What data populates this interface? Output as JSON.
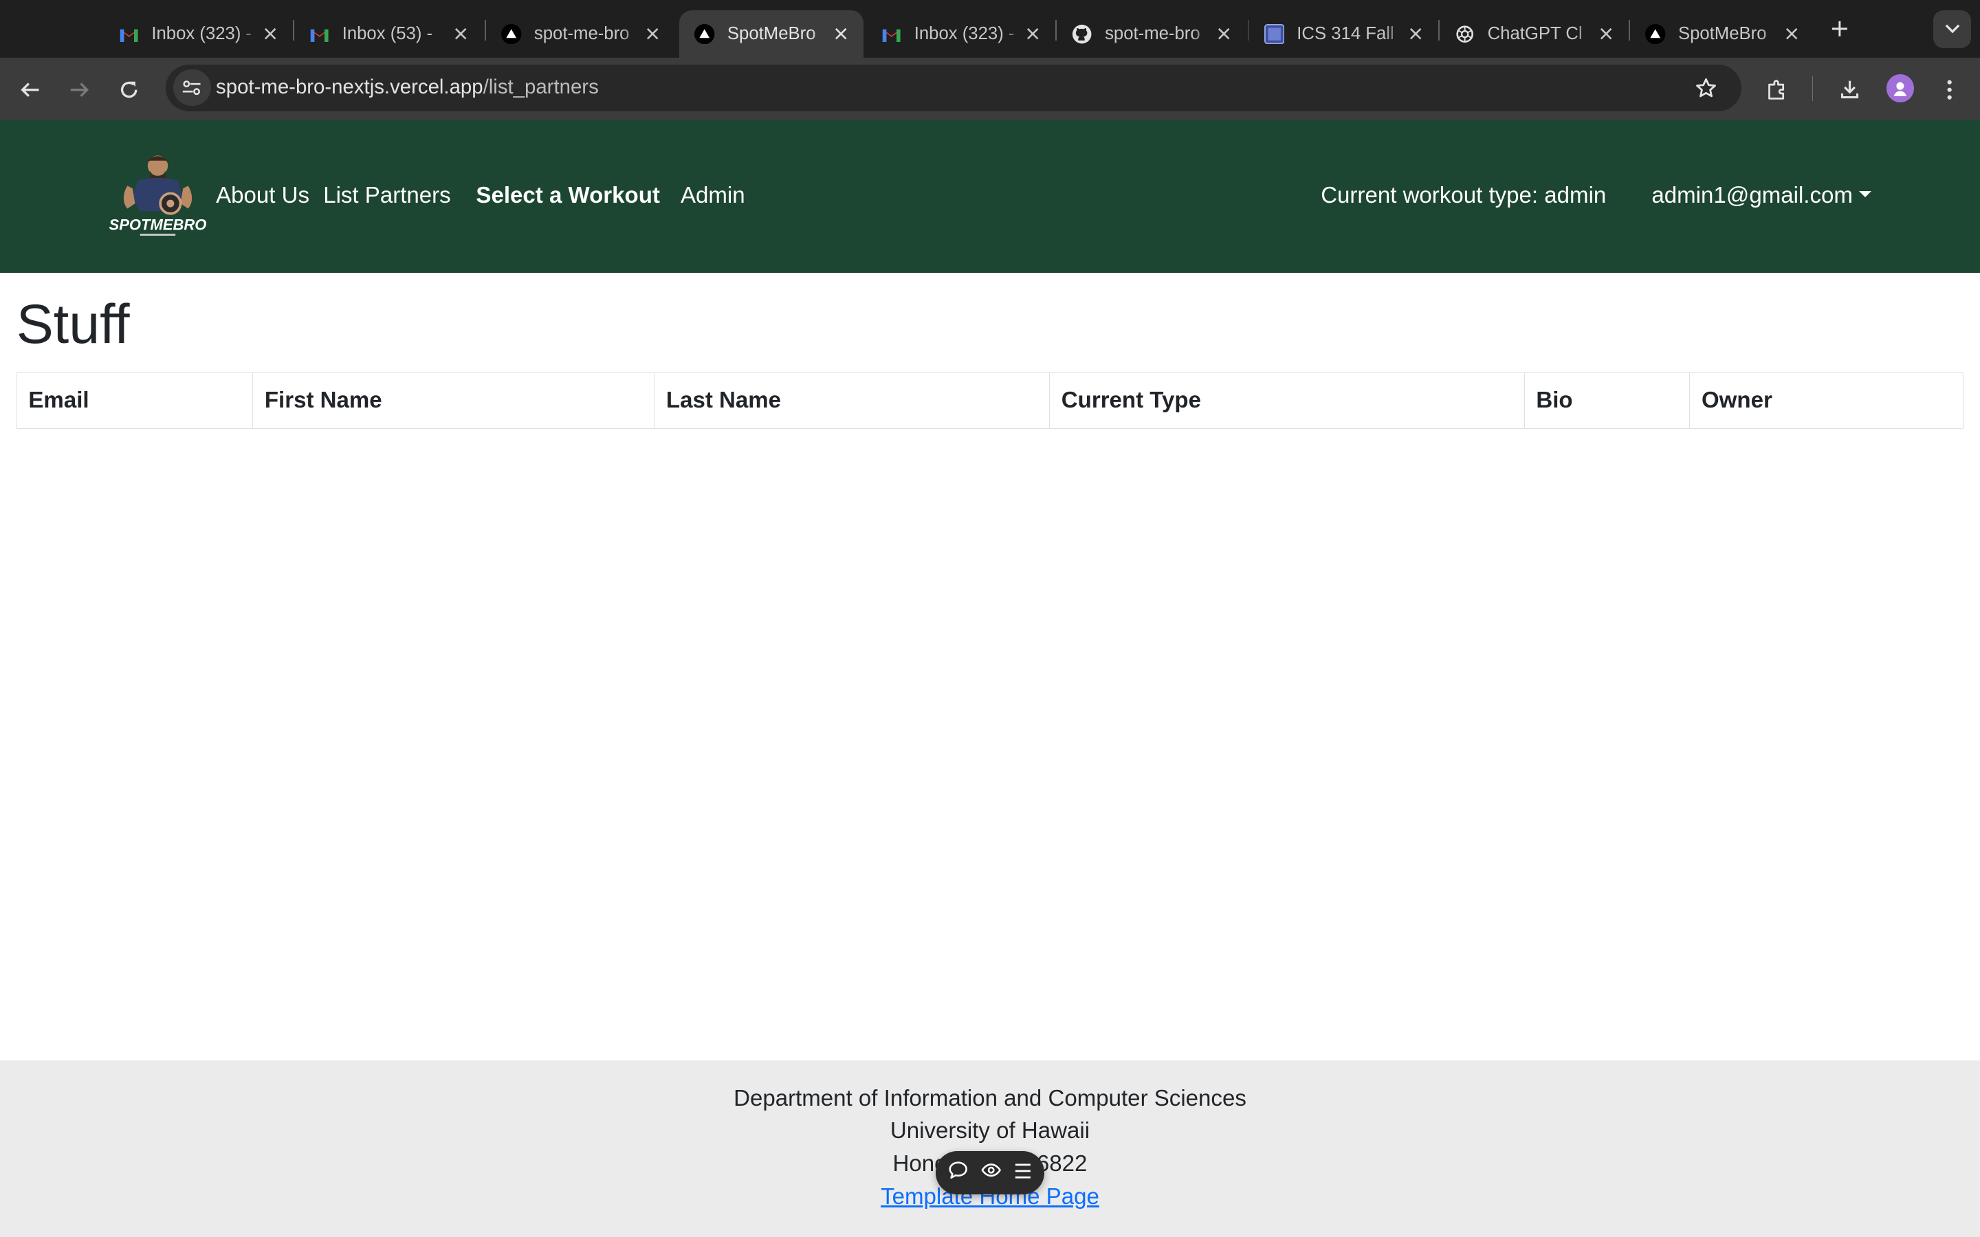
{
  "browser": {
    "tabs": [
      {
        "title": "Inbox (323) - ",
        "icon": "gmail-icon",
        "active": false
      },
      {
        "title": "Inbox (53) - ",
        "icon": "gmail-icon",
        "active": false
      },
      {
        "title": "spot-me-bro",
        "icon": "vercel-icon",
        "active": false
      },
      {
        "title": "SpotMeBro",
        "icon": "vercel-icon",
        "active": true
      },
      {
        "title": "Inbox (323) - ",
        "icon": "gmail-icon",
        "active": false
      },
      {
        "title": "spot-me-bro",
        "icon": "github-icon",
        "active": false
      },
      {
        "title": "ICS 314 Fall",
        "icon": "square-icon",
        "active": false
      },
      {
        "title": "ChatGPT Cl",
        "icon": "openai-icon",
        "active": false
      },
      {
        "title": "SpotMeBro",
        "icon": "vercel-icon",
        "active": false
      }
    ],
    "url_host": "spot-me-bro-nextjs.vercel.app",
    "url_path": "/list_partners"
  },
  "navbar": {
    "logo_text": "SPOTMEBRO",
    "links": [
      "About Us",
      "List Partners",
      "Select a Workout",
      "Admin"
    ],
    "workout_type": "Current workout type: admin",
    "user_email": "admin1@gmail.com"
  },
  "main": {
    "title": "Stuff",
    "columns": [
      "Email",
      "First Name",
      "Last Name",
      "Current Type",
      "Bio",
      "Owner"
    ]
  },
  "footer": {
    "line1": "Department of Information and Computer Sciences",
    "line2": "University of Hawaii",
    "line3": "Honolulu, HI 96822",
    "link": "Template Home Page"
  },
  "colors": {
    "navbar_bg": "#1c4632",
    "footer_bg": "#ebebeb",
    "link": "#0d6efd"
  }
}
